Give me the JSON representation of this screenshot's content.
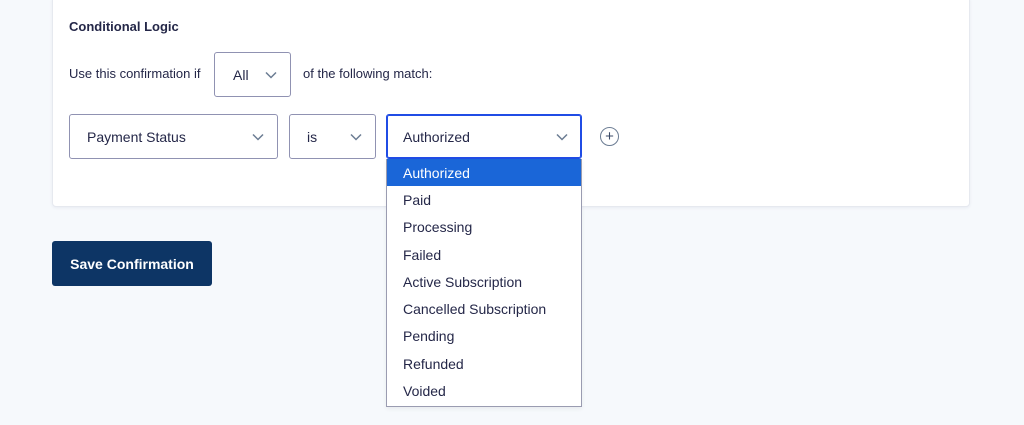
{
  "panel": {
    "title": "Conditional Logic",
    "rule_prefix": "Use this confirmation if",
    "rule_suffix": "of the following match:",
    "match_select": {
      "value": "All"
    }
  },
  "condition": {
    "field_select": {
      "value": "Payment Status"
    },
    "operator_select": {
      "value": "is"
    },
    "value_select": {
      "value": "Authorized"
    },
    "add_button_symbol": "+"
  },
  "dropdown": {
    "options": [
      "Authorized",
      "Paid",
      "Processing",
      "Failed",
      "Active Subscription",
      "Cancelled Subscription",
      "Pending",
      "Refunded",
      "Voided"
    ],
    "selected_index": 0
  },
  "actions": {
    "save_label": "Save Confirmation"
  },
  "colors": {
    "background": "#f6f9fc",
    "text": "#242748",
    "accent_selected": "#1a66d8",
    "focus_border": "#204ce5",
    "primary_button": "#0d3565"
  },
  "icons": {
    "chevron": "chevron-down-icon",
    "add": "plus-circle-icon"
  }
}
